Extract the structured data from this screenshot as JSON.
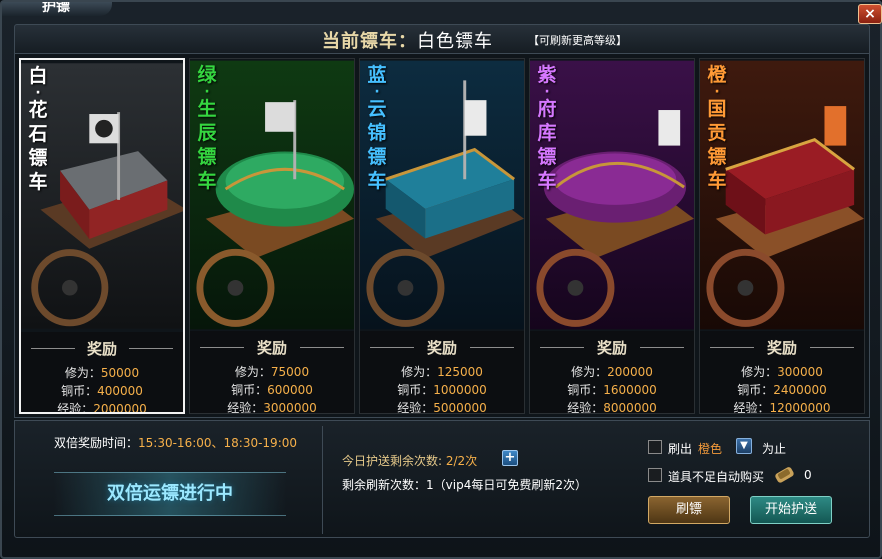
{
  "window": {
    "title": "护镖"
  },
  "header": {
    "label": "当前镖车：",
    "value": "白色镖车",
    "note": "【可刷新更高等级】"
  },
  "reward_title": "奖励",
  "labels": {
    "xiuwei": "修为：",
    "tongbi": "铜币：",
    "jingyan": "经验："
  },
  "carts": [
    {
      "grade": "白",
      "name": [
        "花",
        "石",
        "镖",
        "车"
      ],
      "color": "#ffffff",
      "xiuwei": "50000",
      "tongbi": "400000",
      "jingyan": "2000000"
    },
    {
      "grade": "绿",
      "name": [
        "生",
        "辰",
        "镖",
        "车"
      ],
      "color": "#35d640",
      "xiuwei": "75000",
      "tongbi": "600000",
      "jingyan": "3000000"
    },
    {
      "grade": "蓝",
      "name": [
        "云",
        "锦",
        "镖",
        "车"
      ],
      "color": "#46c0ff",
      "xiuwei": "125000",
      "tongbi": "1000000",
      "jingyan": "5000000"
    },
    {
      "grade": "紫",
      "name": [
        "府",
        "库",
        "镖",
        "车"
      ],
      "color": "#d678ff",
      "xiuwei": "200000",
      "tongbi": "1600000",
      "jingyan": "8000000"
    },
    {
      "grade": "橙",
      "name": [
        "国",
        "贡",
        "镖",
        "车"
      ],
      "color": "#ff9a36",
      "xiuwei": "300000",
      "tongbi": "2400000",
      "jingyan": "12000000"
    }
  ],
  "bottom": {
    "double_label": "双倍奖励时间：",
    "double_time": "15:30-16:00、18:30-19:00",
    "double_banner": "双倍运镖进行中",
    "today_label": "今日护送剩余次数:",
    "today_value": "2/2次",
    "plus": "+",
    "refresh_left": "剩余刷新次数：1（vip4每日可免费刷新2次）",
    "refresh_until_prefix": "刷出",
    "refresh_until_color": "橙色",
    "refresh_until_suffix": "为止",
    "auto_buy": "道具不足自动购买",
    "item_count": "0",
    "refresh_button": "刷镖",
    "start_button": "开始护送"
  }
}
